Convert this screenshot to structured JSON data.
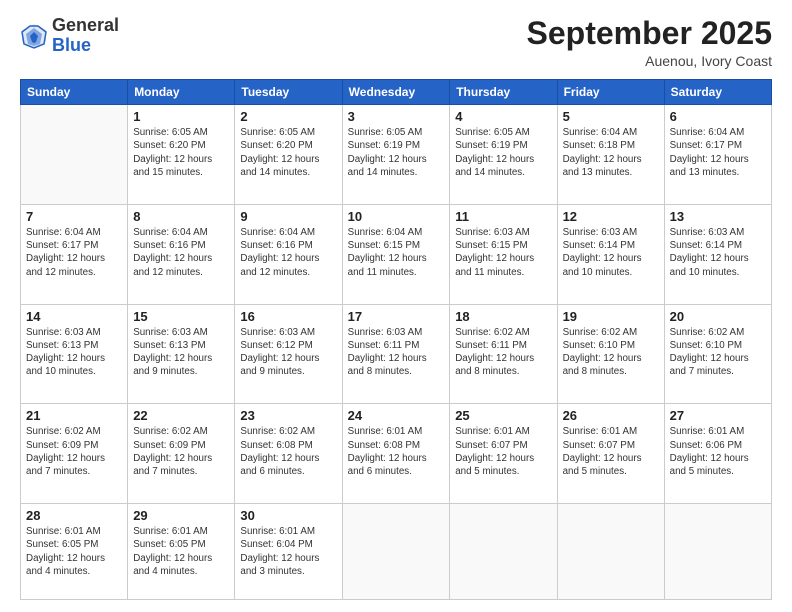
{
  "logo": {
    "general": "General",
    "blue": "Blue"
  },
  "header": {
    "month": "September 2025",
    "location": "Auenou, Ivory Coast"
  },
  "weekdays": [
    "Sunday",
    "Monday",
    "Tuesday",
    "Wednesday",
    "Thursday",
    "Friday",
    "Saturday"
  ],
  "weeks": [
    [
      {
        "day": "",
        "info": ""
      },
      {
        "day": "1",
        "info": "Sunrise: 6:05 AM\nSunset: 6:20 PM\nDaylight: 12 hours\nand 15 minutes."
      },
      {
        "day": "2",
        "info": "Sunrise: 6:05 AM\nSunset: 6:20 PM\nDaylight: 12 hours\nand 14 minutes."
      },
      {
        "day": "3",
        "info": "Sunrise: 6:05 AM\nSunset: 6:19 PM\nDaylight: 12 hours\nand 14 minutes."
      },
      {
        "day": "4",
        "info": "Sunrise: 6:05 AM\nSunset: 6:19 PM\nDaylight: 12 hours\nand 14 minutes."
      },
      {
        "day": "5",
        "info": "Sunrise: 6:04 AM\nSunset: 6:18 PM\nDaylight: 12 hours\nand 13 minutes."
      },
      {
        "day": "6",
        "info": "Sunrise: 6:04 AM\nSunset: 6:17 PM\nDaylight: 12 hours\nand 13 minutes."
      }
    ],
    [
      {
        "day": "7",
        "info": "Sunrise: 6:04 AM\nSunset: 6:17 PM\nDaylight: 12 hours\nand 12 minutes."
      },
      {
        "day": "8",
        "info": "Sunrise: 6:04 AM\nSunset: 6:16 PM\nDaylight: 12 hours\nand 12 minutes."
      },
      {
        "day": "9",
        "info": "Sunrise: 6:04 AM\nSunset: 6:16 PM\nDaylight: 12 hours\nand 12 minutes."
      },
      {
        "day": "10",
        "info": "Sunrise: 6:04 AM\nSunset: 6:15 PM\nDaylight: 12 hours\nand 11 minutes."
      },
      {
        "day": "11",
        "info": "Sunrise: 6:03 AM\nSunset: 6:15 PM\nDaylight: 12 hours\nand 11 minutes."
      },
      {
        "day": "12",
        "info": "Sunrise: 6:03 AM\nSunset: 6:14 PM\nDaylight: 12 hours\nand 10 minutes."
      },
      {
        "day": "13",
        "info": "Sunrise: 6:03 AM\nSunset: 6:14 PM\nDaylight: 12 hours\nand 10 minutes."
      }
    ],
    [
      {
        "day": "14",
        "info": "Sunrise: 6:03 AM\nSunset: 6:13 PM\nDaylight: 12 hours\nand 10 minutes."
      },
      {
        "day": "15",
        "info": "Sunrise: 6:03 AM\nSunset: 6:13 PM\nDaylight: 12 hours\nand 9 minutes."
      },
      {
        "day": "16",
        "info": "Sunrise: 6:03 AM\nSunset: 6:12 PM\nDaylight: 12 hours\nand 9 minutes."
      },
      {
        "day": "17",
        "info": "Sunrise: 6:03 AM\nSunset: 6:11 PM\nDaylight: 12 hours\nand 8 minutes."
      },
      {
        "day": "18",
        "info": "Sunrise: 6:02 AM\nSunset: 6:11 PM\nDaylight: 12 hours\nand 8 minutes."
      },
      {
        "day": "19",
        "info": "Sunrise: 6:02 AM\nSunset: 6:10 PM\nDaylight: 12 hours\nand 8 minutes."
      },
      {
        "day": "20",
        "info": "Sunrise: 6:02 AM\nSunset: 6:10 PM\nDaylight: 12 hours\nand 7 minutes."
      }
    ],
    [
      {
        "day": "21",
        "info": "Sunrise: 6:02 AM\nSunset: 6:09 PM\nDaylight: 12 hours\nand 7 minutes."
      },
      {
        "day": "22",
        "info": "Sunrise: 6:02 AM\nSunset: 6:09 PM\nDaylight: 12 hours\nand 7 minutes."
      },
      {
        "day": "23",
        "info": "Sunrise: 6:02 AM\nSunset: 6:08 PM\nDaylight: 12 hours\nand 6 minutes."
      },
      {
        "day": "24",
        "info": "Sunrise: 6:01 AM\nSunset: 6:08 PM\nDaylight: 12 hours\nand 6 minutes."
      },
      {
        "day": "25",
        "info": "Sunrise: 6:01 AM\nSunset: 6:07 PM\nDaylight: 12 hours\nand 5 minutes."
      },
      {
        "day": "26",
        "info": "Sunrise: 6:01 AM\nSunset: 6:07 PM\nDaylight: 12 hours\nand 5 minutes."
      },
      {
        "day": "27",
        "info": "Sunrise: 6:01 AM\nSunset: 6:06 PM\nDaylight: 12 hours\nand 5 minutes."
      }
    ],
    [
      {
        "day": "28",
        "info": "Sunrise: 6:01 AM\nSunset: 6:05 PM\nDaylight: 12 hours\nand 4 minutes."
      },
      {
        "day": "29",
        "info": "Sunrise: 6:01 AM\nSunset: 6:05 PM\nDaylight: 12 hours\nand 4 minutes."
      },
      {
        "day": "30",
        "info": "Sunrise: 6:01 AM\nSunset: 6:04 PM\nDaylight: 12 hours\nand 3 minutes."
      },
      {
        "day": "",
        "info": ""
      },
      {
        "day": "",
        "info": ""
      },
      {
        "day": "",
        "info": ""
      },
      {
        "day": "",
        "info": ""
      }
    ]
  ]
}
